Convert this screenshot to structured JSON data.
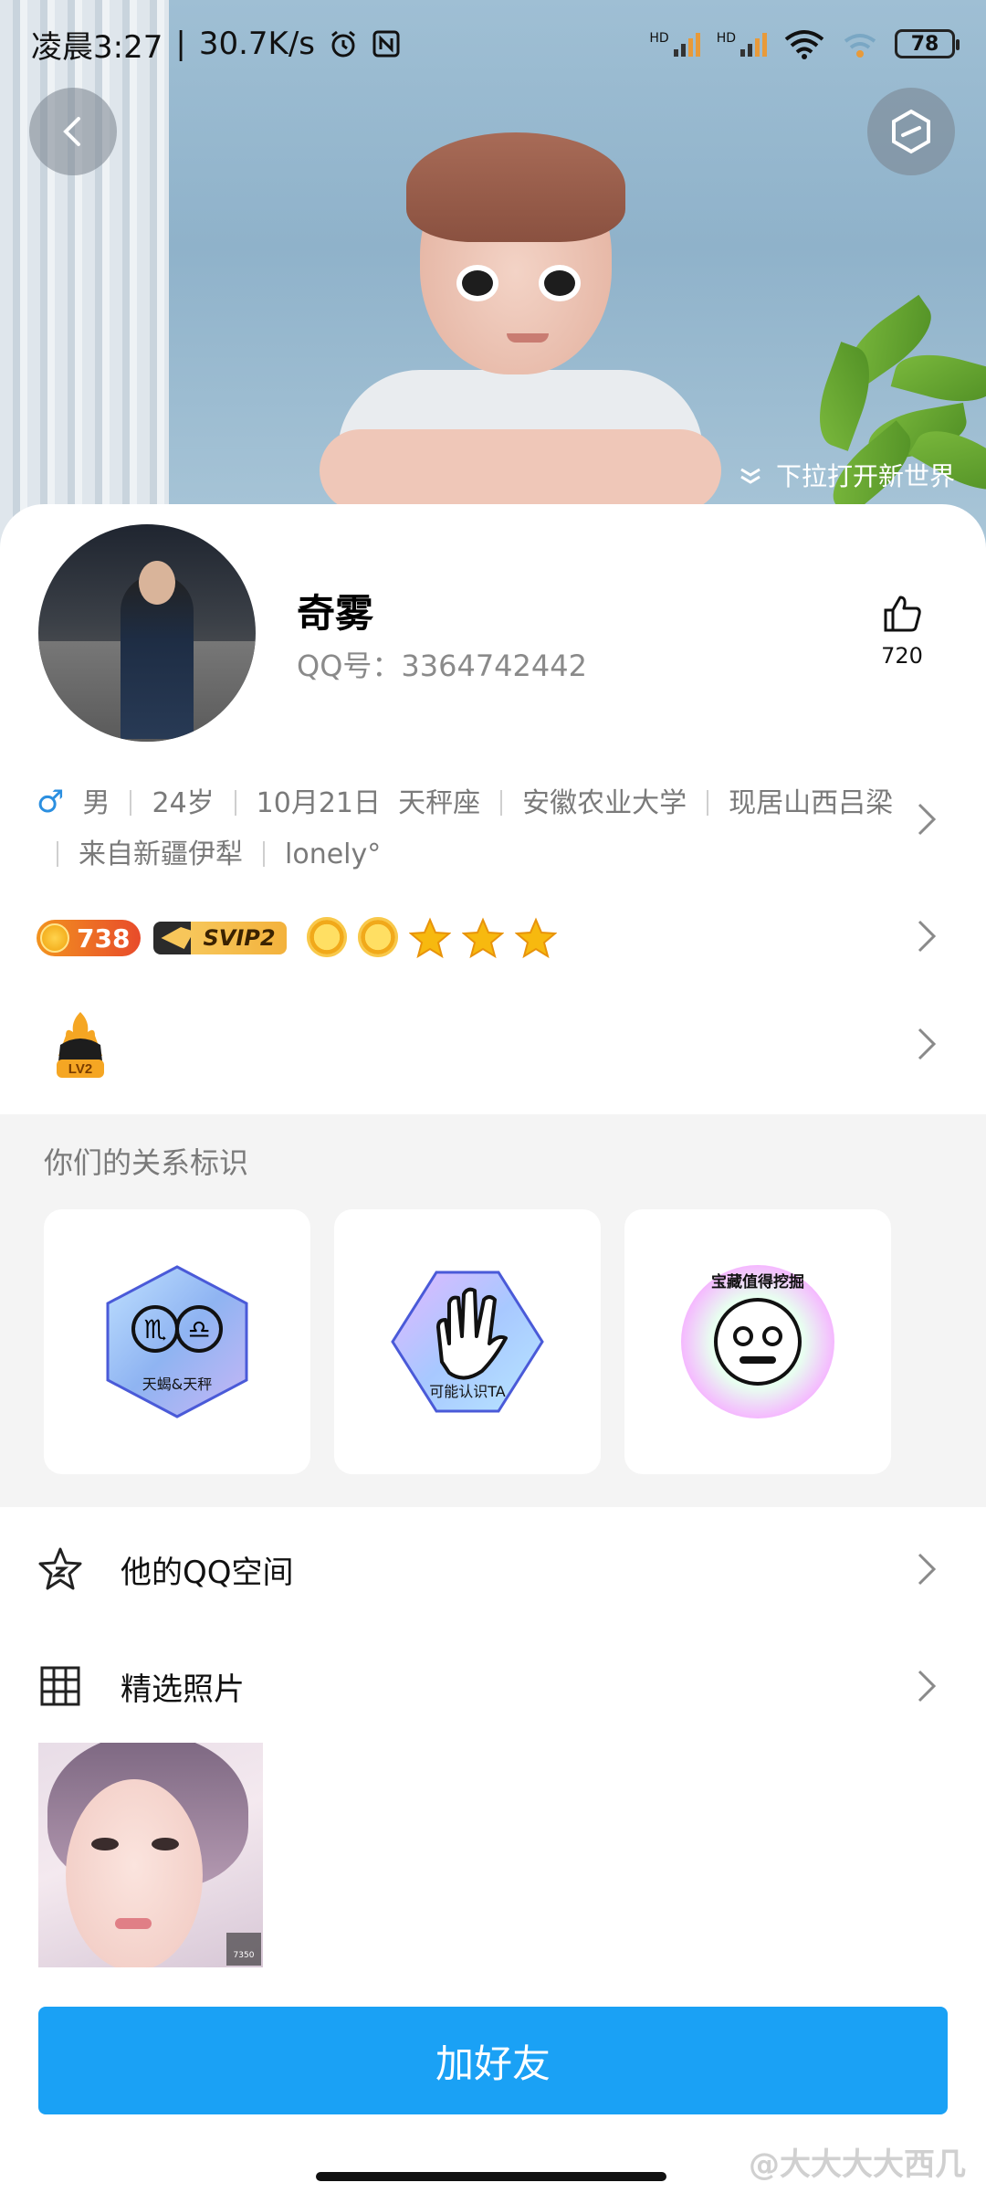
{
  "status_bar": {
    "time": "凌晨3:27",
    "speed": "30.7K/s",
    "battery": "78",
    "signal_label": "HD"
  },
  "hero": {
    "pull_hint": "下拉打开新世界"
  },
  "profile": {
    "name": "奇雾",
    "qq_label": "QQ号：3364742442",
    "likes": "720"
  },
  "info": {
    "gender": "男",
    "age": "24岁",
    "birthday": "10月21日",
    "zodiac": "天秤座",
    "school": "安徽农业大学",
    "residence": "现居山西吕梁",
    "hometown": "来自新疆伊犁",
    "signature": "lonely°"
  },
  "badges": {
    "gold_count": "738",
    "svip": "SVIP2",
    "level_badge": "LV2"
  },
  "relations": {
    "title": "你们的关系标识",
    "cards": [
      {
        "label": "天蝎&天秤"
      },
      {
        "label": "可能认识TA"
      },
      {
        "label": "宝藏值得挖掘"
      }
    ]
  },
  "menu": {
    "qzone": "他的QQ空间",
    "photos": "精选照片"
  },
  "photo": {
    "likes": "7350"
  },
  "add_friend": "加好友",
  "watermark": "@大大大大西几",
  "colors": {
    "accent_blue": "#1aa1f5",
    "male_blue": "#2b8fe0"
  }
}
